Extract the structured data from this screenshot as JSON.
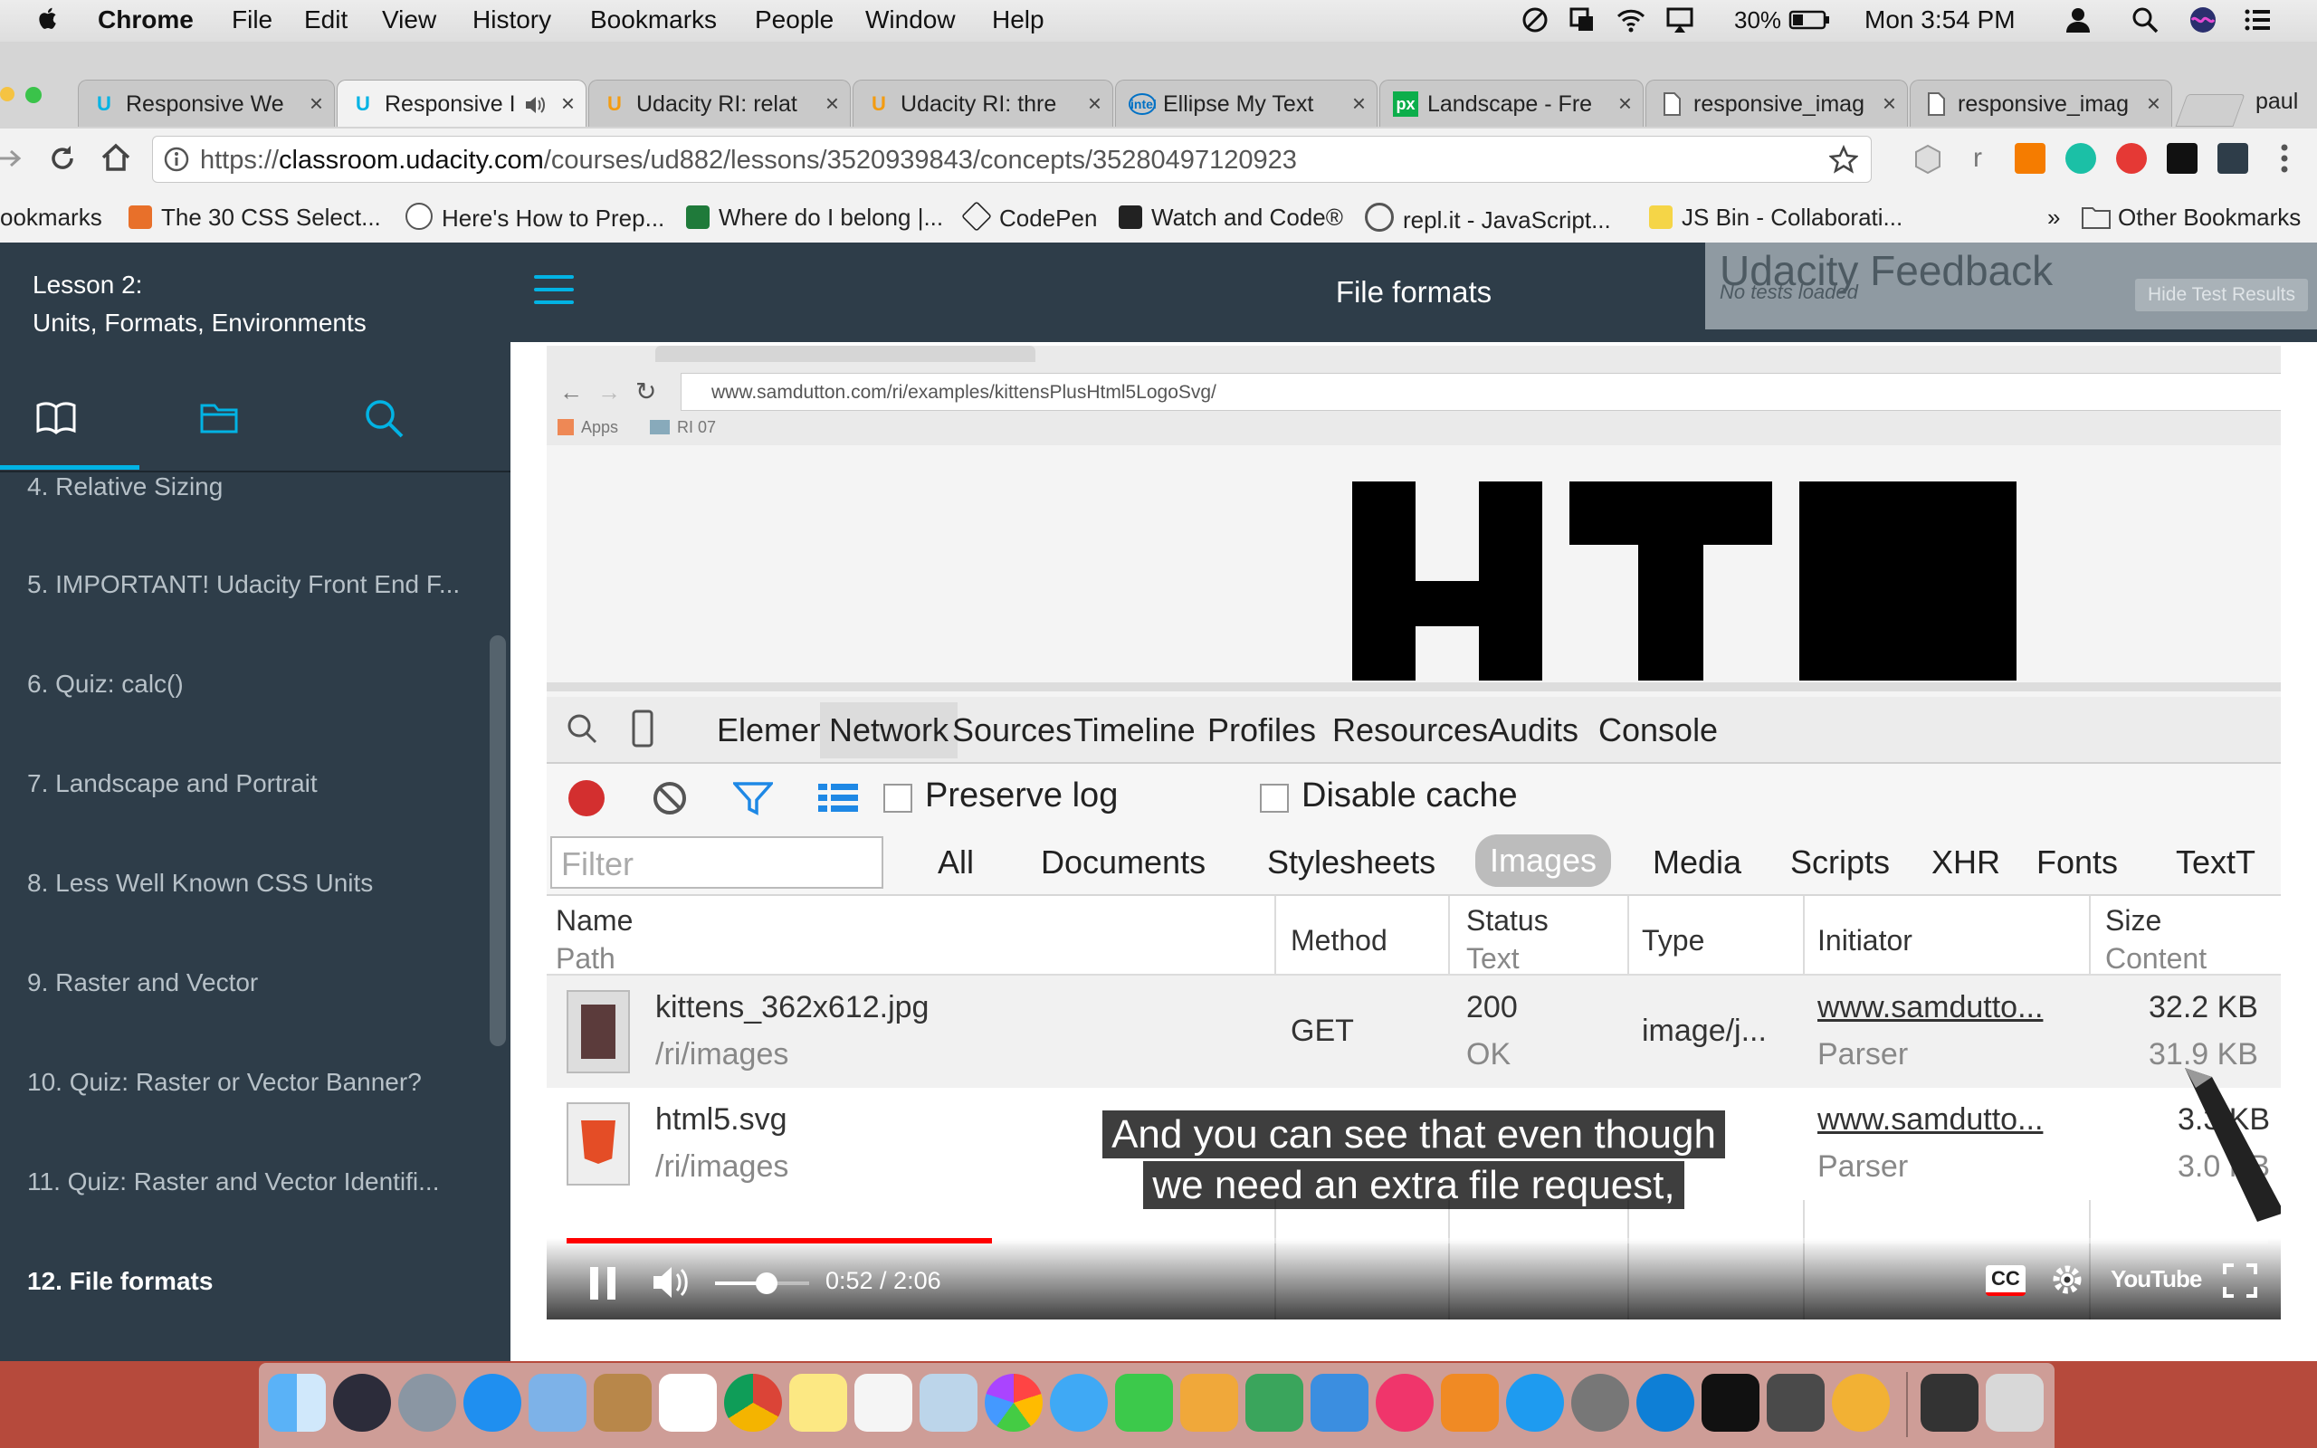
{
  "menubar": {
    "app_name": "Chrome",
    "menus": [
      "File",
      "Edit",
      "View",
      "History",
      "Bookmarks",
      "People",
      "Window",
      "Help"
    ],
    "battery": "30%",
    "clock": "Mon 3:54 PM"
  },
  "tabs": [
    {
      "title": "Responsive We",
      "icon": "udacity-icon",
      "close": "×"
    },
    {
      "title": "Responsive I",
      "icon": "udacity-icon",
      "close": "×",
      "active": true
    },
    {
      "title": "Udacity RI: relat",
      "icon": "udacity-u-icon",
      "close": "×"
    },
    {
      "title": "Udacity RI: thre",
      "icon": "udacity-u-icon",
      "close": "×"
    },
    {
      "title": "Ellipse My Text",
      "icon": "intel-icon",
      "close": "×"
    },
    {
      "title": "Landscape - Fre",
      "icon": "px-icon",
      "close": "×"
    },
    {
      "title": "responsive_imag",
      "icon": "document-icon",
      "close": "×"
    },
    {
      "title": "responsive_imag",
      "icon": "document-icon",
      "close": "×"
    }
  ],
  "profile_name": "paul",
  "omnibox": {
    "scheme": "https://",
    "host": "classroom.udacity.com",
    "path": "/courses/ud882/lessons/3520939843/concepts/35280497120923"
  },
  "toolbar": {
    "ext_r_label": "r"
  },
  "bookmarks": {
    "items": [
      {
        "label": "ookmarks"
      },
      {
        "label": "The 30 CSS Select..."
      },
      {
        "label": "Here's How to Prep..."
      },
      {
        "label": "Where do I belong |..."
      },
      {
        "label": "CodePen"
      },
      {
        "label": "Watch and Code®"
      },
      {
        "label": "repl.it - JavaScript..."
      },
      {
        "label": "JS Bin - Collaborati..."
      }
    ],
    "overflow": "»",
    "other": "Other Bookmarks"
  },
  "sidebar": {
    "lesson_line1": "Lesson 2:",
    "lesson_line2": "Units, Formats, Environments",
    "concepts": [
      {
        "label": "4. Relative Sizing"
      },
      {
        "label": "5. IMPORTANT! Udacity Front End F..."
      },
      {
        "label": "6. Quiz: calc()"
      },
      {
        "label": "7. Landscape and Portrait"
      },
      {
        "label": "8. Less Well Known CSS Units"
      },
      {
        "label": "9. Raster and Vector"
      },
      {
        "label": "10. Quiz: Raster or Vector Banner?"
      },
      {
        "label": "11. Quiz: Raster and Vector Identifi..."
      },
      {
        "label": "12. File formats",
        "current": true
      }
    ]
  },
  "header": {
    "title": "File formats"
  },
  "feedback": {
    "title": "Udacity Feedback",
    "subtitle": "No tests loaded",
    "button": "Hide Test Results"
  },
  "video": {
    "browser_url": "www.samdutton.com/ri/examples/kittensPlusHtml5LogoSvg/",
    "bookmark_apps": "Apps",
    "bookmark_folder": "RI 07",
    "devtools_tabs": [
      "Elements",
      "Network",
      "Sources",
      "Timeline",
      "Profiles",
      "Resources",
      "Audits",
      "Console"
    ],
    "preserve_log": "Preserve log",
    "disable_cache": "Disable cache",
    "filter_placeholder": "Filter",
    "filter_types": [
      "All",
      "Documents",
      "Stylesheets",
      "Images",
      "Media",
      "Scripts",
      "XHR",
      "Fonts",
      "TextT"
    ],
    "columns": {
      "name": "Name",
      "name_sub": "Path",
      "method": "Method",
      "status": "Status",
      "status_sub": "Text",
      "type": "Type",
      "initiator": "Initiator",
      "size": "Size",
      "size_sub": "Content"
    },
    "rows": [
      {
        "name": "kittens_362x612.jpg",
        "path": "/ri/images",
        "method": "GET",
        "status": "200",
        "status_text": "OK",
        "type": "image/j...",
        "initiator": "www.samdutto...",
        "initiator_sub": "Parser",
        "size": "32.2 KB",
        "content": "31.9 KB"
      },
      {
        "name": "html5.svg",
        "path": "/ri/images",
        "method": "",
        "status": "",
        "status_text": "",
        "type": "",
        "initiator": "www.samdutto...",
        "initiator_sub": "Parser",
        "size": "3.3 KB",
        "content": "3.0 KB"
      }
    ],
    "caption_line1": "And you can see that even though",
    "caption_line2": "we need an extra file request,",
    "time": "0:52 / 2:06",
    "progress_fraction": 0.25,
    "volume_fraction": 0.55,
    "cc_label": "CC",
    "youtube_label": "YouTube"
  },
  "colors": {
    "udacity_blue": "#02b3e4",
    "sidebar_bg": "#2e3d49",
    "record_red": "#d32f2f",
    "progress_red": "#ff0000"
  }
}
